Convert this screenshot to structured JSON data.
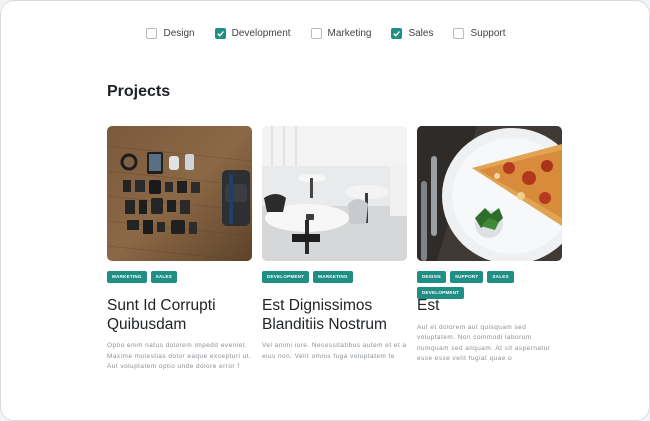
{
  "filters": [
    {
      "label": "Design",
      "checked": false
    },
    {
      "label": "Development",
      "checked": true
    },
    {
      "label": "Marketing",
      "checked": false
    },
    {
      "label": "Sales",
      "checked": true
    },
    {
      "label": "Support",
      "checked": false
    }
  ],
  "section": {
    "title": "Projects"
  },
  "colors": {
    "accent": "#1f8f85"
  },
  "projects": [
    {
      "image": "gadgets-flatlay-photo",
      "tags": [
        "MARKETING",
        "SALES"
      ],
      "title": "Sunt Id Corrupti Quibusdam",
      "description": "Optio enim natus dolorem impedit eveniet. Maxime molestias dolor eaque excepturi ut. Aut voluptatem optio unde dolore error f"
    },
    {
      "image": "white-cafe-interior-photo",
      "tags": [
        "DEVELOPMENT",
        "MARKETING"
      ],
      "title": "Est Dignissimos Blanditiis Nostrum",
      "description": "Vel animi iure. Necessitatibus autem et et a eius non. Velit omnis fuga voluptatem te"
    },
    {
      "image": "pizza-slice-plate-photo",
      "tags": [
        "DESIGN",
        "SUPPORT",
        "SALES",
        "DEVELOPMENT"
      ],
      "title": "Est",
      "description": "Aut et dolorem aut quisquam sed voluptatem. Non commodi laborum numquam sed aliquam. At sit aspernatur esse esse velit fugiat quae o"
    }
  ]
}
